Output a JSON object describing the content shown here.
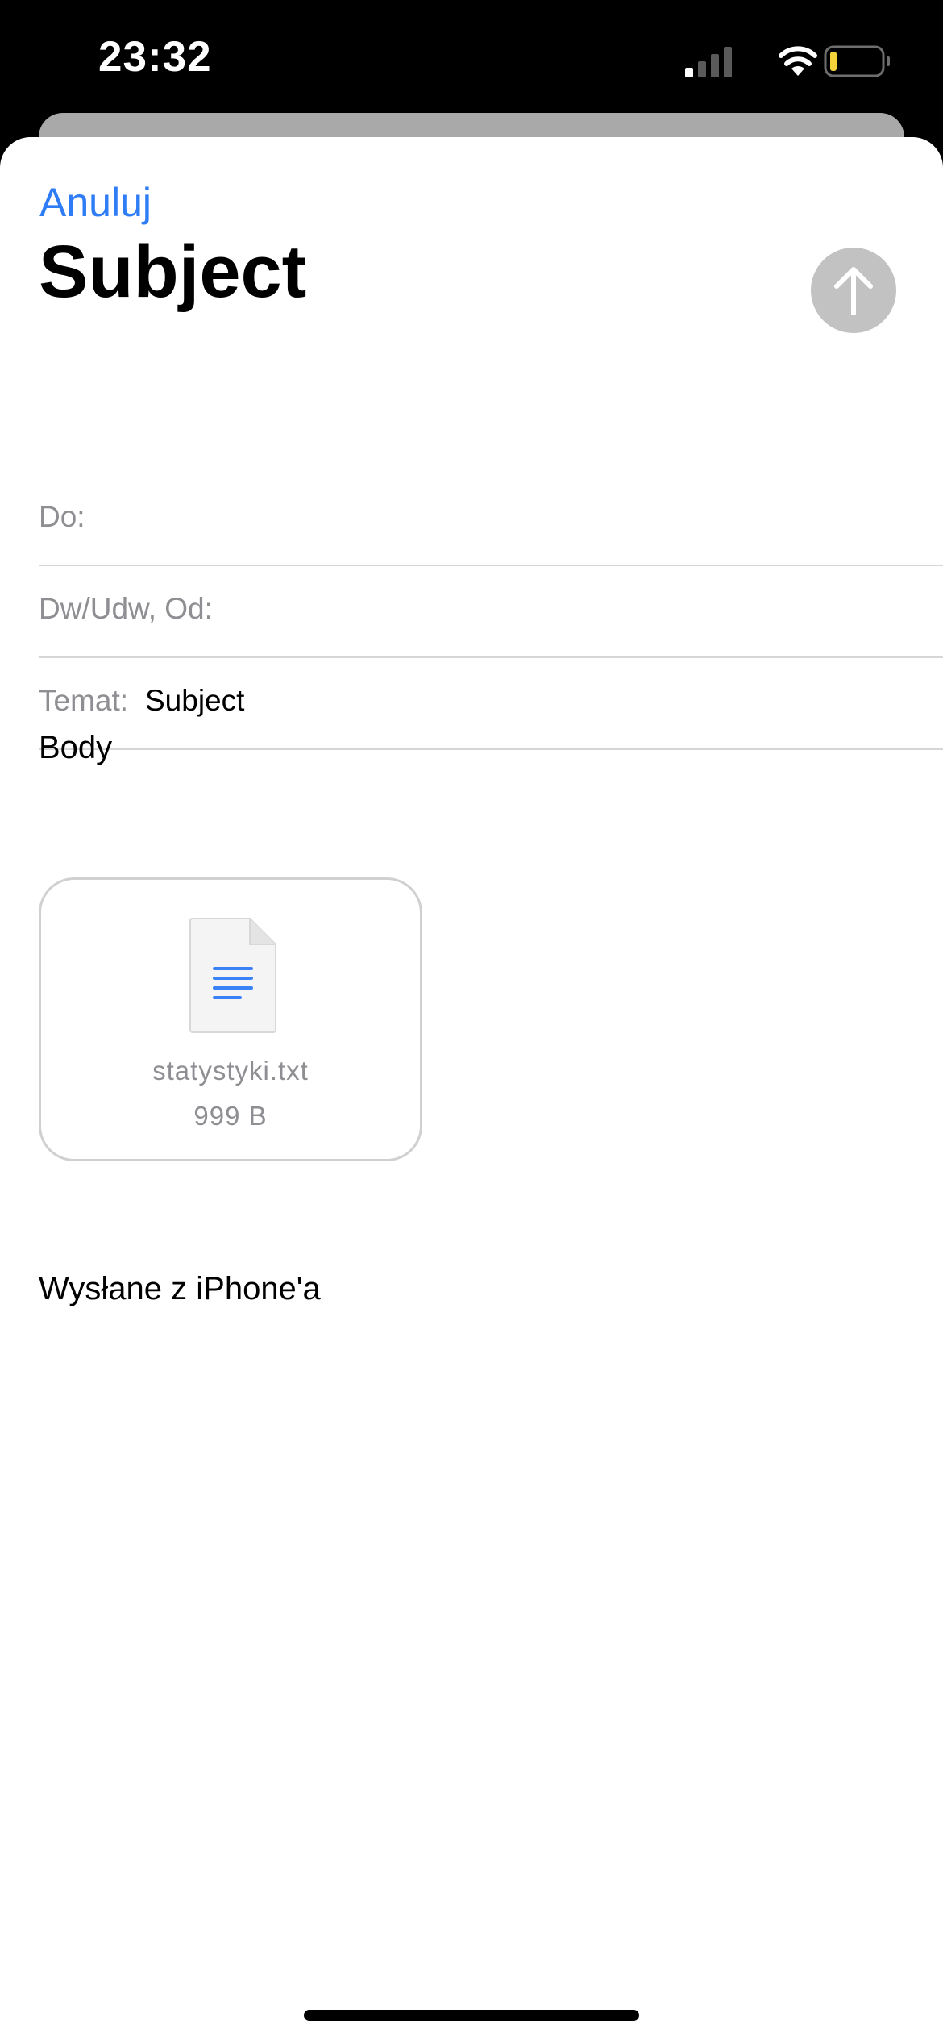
{
  "status_bar": {
    "time": "23:32",
    "icons": [
      "signal-icon",
      "wifi-icon",
      "battery-icon"
    ],
    "battery_color": "#f5d23a"
  },
  "header": {
    "cancel_label": "Anuluj",
    "title": "Subject",
    "send_icon": "arrow-up-icon"
  },
  "fields": {
    "to_label": "Do:",
    "cc_label": "Dw/Udw, Od:",
    "subject_label": "Temat:",
    "subject_value": "Subject"
  },
  "body": {
    "text": "Body",
    "signature": "Wysłane z iPhone'a"
  },
  "attachment": {
    "icon": "text-document-icon",
    "name": "statystyki.txt",
    "size": "999 B"
  },
  "colors": {
    "accent": "#2e7cf6",
    "send_button": "#c2c2c2"
  }
}
